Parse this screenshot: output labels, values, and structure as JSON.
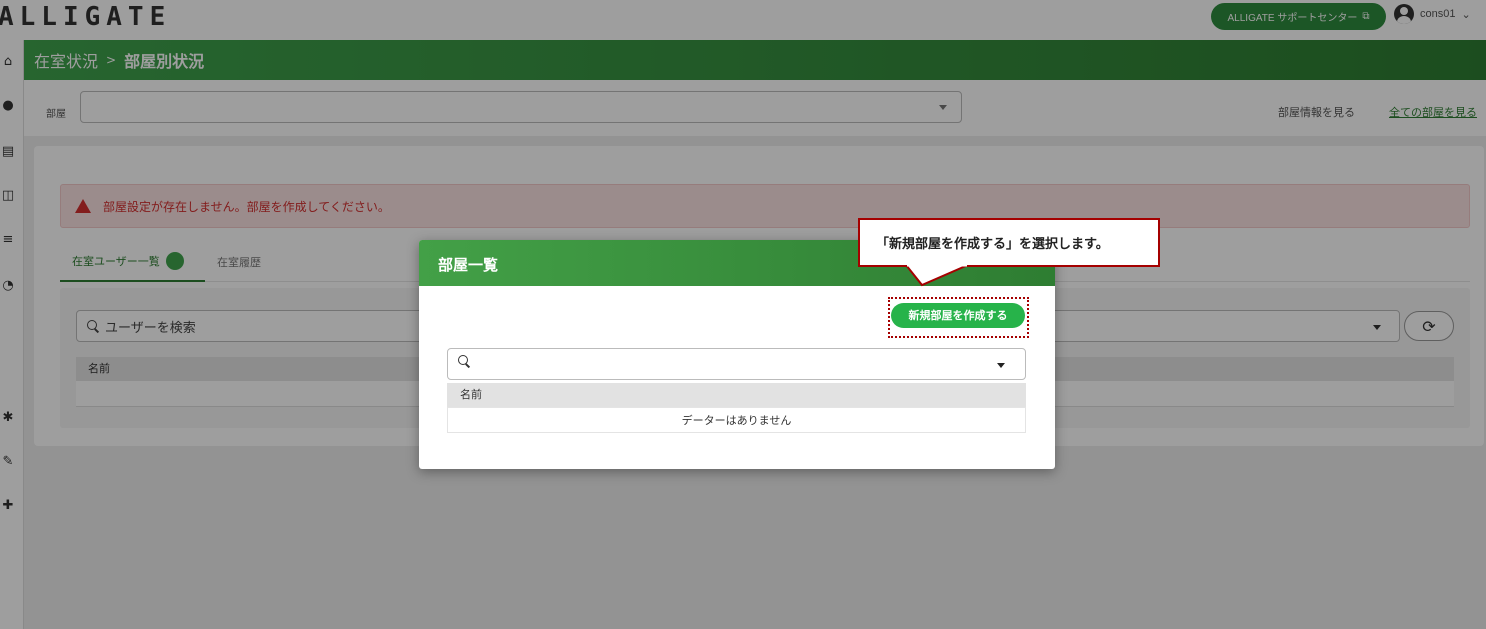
{
  "app": {
    "logo": "ALLIGATE",
    "support_label": "ALLIGATE サポートセンター",
    "user_name": "cons01"
  },
  "breadcrumb": {
    "parent": "在室状況",
    "separator": ">",
    "current": "部屋別状況"
  },
  "room_bar": {
    "label": "部屋",
    "info_link": "部屋情報を見る",
    "all_link": "全ての部屋を見る"
  },
  "alert": {
    "message": "部屋設定が存在しません。部屋を作成してください。"
  },
  "tabs": [
    {
      "label": "在室ユーザー一覧"
    },
    {
      "label": "在室履歴"
    }
  ],
  "user_search": {
    "placeholder": "ユーザーを検索"
  },
  "user_table": {
    "columns": [
      "名前"
    ]
  },
  "modal": {
    "title": "部屋一覧",
    "new_room_label": "新規部屋を作成する",
    "columns": [
      "名前"
    ],
    "empty_text": "データーはありません"
  },
  "callout": {
    "text": "「新規部屋を作成する」を選択します。"
  },
  "colors": {
    "brand_green": "#2e7d32",
    "button_green": "#27b34a",
    "alert_red": "#d32f2f",
    "annotation_red": "#a50000"
  }
}
